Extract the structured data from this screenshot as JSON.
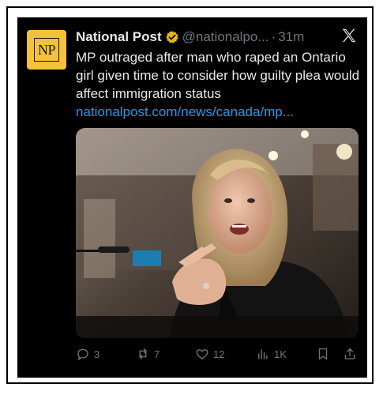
{
  "tweet": {
    "author_name": "National Post",
    "author_handle": "@nationalpo...",
    "separator": "·",
    "time_ago": "31m",
    "avatar_text": "NP",
    "text": "MP outraged after man who raped an Ontario girl given time to consider how guilty plea would affect immigration status",
    "link_text": "nationalpost.com/news/canada/mp...",
    "verified_badge_color": "#e2b719",
    "link_color": "#1d9bf0",
    "background_color": "#000000"
  },
  "actions": {
    "replies": "3",
    "reposts": "7",
    "likes": "12",
    "views": "1K"
  },
  "icons": {
    "reply": "reply-icon",
    "repost": "repost-icon",
    "like": "heart-icon",
    "views": "views-icon",
    "bookmark": "bookmark-icon",
    "share": "share-icon",
    "platform": "x-logo-icon"
  }
}
